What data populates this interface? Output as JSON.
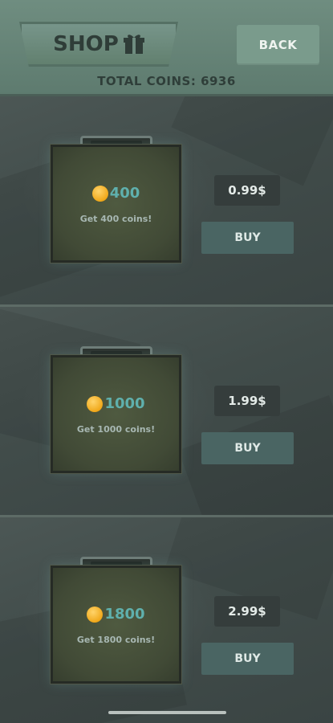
{
  "header": {
    "title": "SHOP",
    "title_icon": "gift-icon",
    "back_label": "BACK",
    "total_coins_label": "TOTAL COINS:",
    "total_coins_value": "6936"
  },
  "offers": [
    {
      "amount": "400",
      "description": "Get 400 coins!",
      "price": "0.99$",
      "buy_label": "BUY",
      "icon": "coin-icon"
    },
    {
      "amount": "1000",
      "description": "Get 1000 coins!",
      "price": "1.99$",
      "buy_label": "BUY",
      "icon": "coin-icon"
    },
    {
      "amount": "1800",
      "description": "Get 1800 coins!",
      "price": "2.99$",
      "buy_label": "BUY",
      "icon": "coin-icon"
    }
  ],
  "colors": {
    "header_bg": "#6f8d80",
    "coin_amount": "#5fb0ad",
    "coin_gold": "#f0a81a",
    "buy_button": "#4a6563",
    "price_tag": "#353d3c"
  }
}
